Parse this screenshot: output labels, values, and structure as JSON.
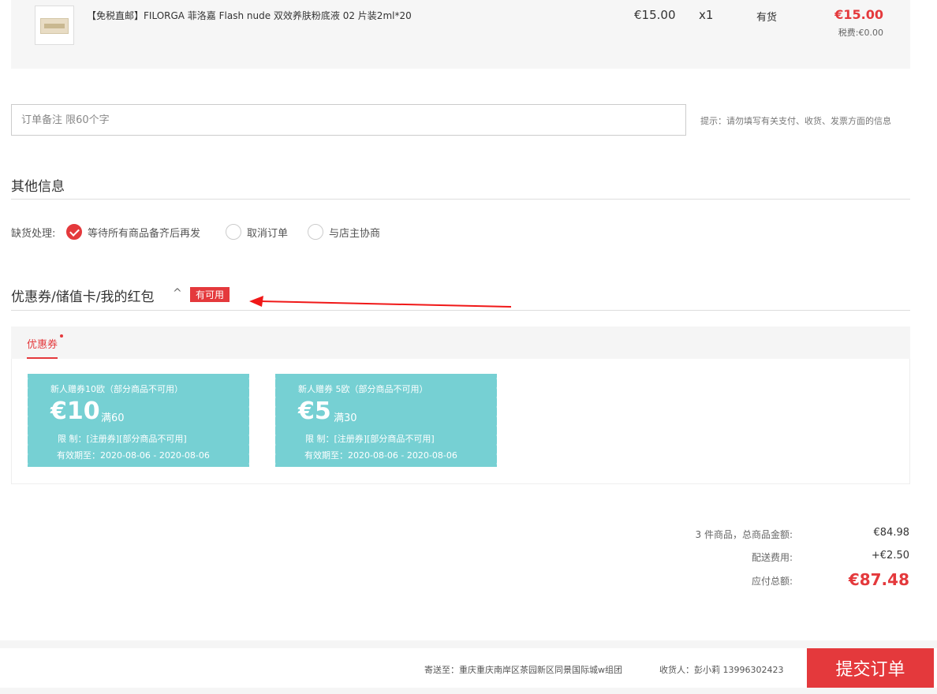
{
  "product": {
    "name": "【免税直邮】FILORGA 菲洛嘉 Flash nude 双效养肤粉底液 02 片装2ml*20",
    "price": "€15.00",
    "qty": "x1",
    "stock": "有货",
    "subtotal": "€15.00",
    "tax": "税费:€0.00",
    "image_icon": "product-thumbnail"
  },
  "remark": {
    "placeholder": "订单备注 限60个字",
    "value": "",
    "hint": "提示：请勿填写有关支付、收货、发票方面的信息"
  },
  "other_info": {
    "title": "其他信息",
    "stockout_label": "缺货处理:",
    "options": [
      {
        "label": "等待所有商品备齐后再发",
        "checked": true
      },
      {
        "label": "取消订单",
        "checked": false
      },
      {
        "label": "与店主协商",
        "checked": false
      }
    ]
  },
  "coupons": {
    "title": "优惠券/储值卡/我的红包",
    "chevron": "^",
    "badge": "有可用",
    "tab_label": "优惠券",
    "items": [
      {
        "name": "新人赠券10欧（部分商品不可用）",
        "amount": "€10",
        "min": "满60",
        "limit": "限 制：[注册券][部分商品不可用]",
        "valid": "有效期至：2020-08-06 - 2020-08-06"
      },
      {
        "name": "新人赠券 5欧（部分商品不可用）",
        "amount": "€5",
        "min": "满30",
        "limit": "限 制：[注册券][部分商品不可用]",
        "valid": "有效期至：2020-08-06 - 2020-08-06"
      }
    ]
  },
  "totals": {
    "goods_label": "3 件商品，总商品金额:",
    "goods_value": "€84.98",
    "shipping_label": "配送费用:",
    "shipping_value": "+€2.50",
    "payable_label": "应付总额:",
    "payable_value": "€87.48"
  },
  "footer": {
    "ship_to": "寄送至：重庆重庆南岸区茶园新区同景国际城w组团",
    "receiver": "收货人：彭小莉  13996302423",
    "submit_label": "提交订单"
  },
  "colors": {
    "accent": "#e4393c",
    "coupon": "#76d0d3",
    "annotation_arrow": "#f01818"
  }
}
